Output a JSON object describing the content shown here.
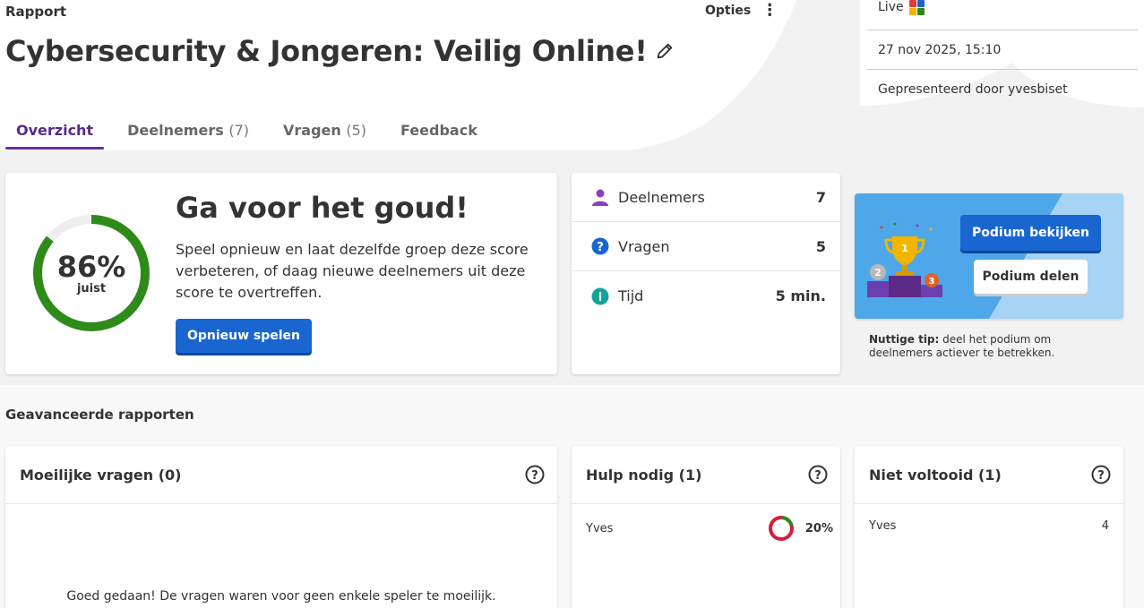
{
  "header": {
    "section_label": "Rapport",
    "options_label": "Opties",
    "options_icon": "more-vertical-icon",
    "title": "Cybersecurity & Jongeren: Veilig Online!",
    "edit_icon": "pencil-icon"
  },
  "tabs": [
    {
      "label": "Overzicht",
      "count": "",
      "active": true
    },
    {
      "label": "Deelnemers",
      "count": "(7)",
      "active": false
    },
    {
      "label": "Vragen",
      "count": "(5)",
      "active": false
    },
    {
      "label": "Feedback",
      "count": "",
      "active": false
    }
  ],
  "meta": {
    "mode": "Live",
    "date": "27 nov 2025, 15:10",
    "presenter": "Gepresenteerd door yvesbiset"
  },
  "score": {
    "percent_label": "86%",
    "percent_value": 86,
    "sub_label": "juist",
    "heading": "Ga voor het goud!",
    "body": "Speel opnieuw en laat dezelfde groep deze score verbeteren, of daag nieuwe deelnemers uit deze score te overtreffen.",
    "replay_label": "Opnieuw spelen",
    "color": "#2e8b1a"
  },
  "stats": [
    {
      "icon": "person-icon",
      "label": "Deelnemers",
      "value": "7"
    },
    {
      "icon": "question-icon",
      "label": "Vragen",
      "value": "5"
    },
    {
      "icon": "timer-icon",
      "label": "Tijd",
      "value": "5 min."
    }
  ],
  "podium": {
    "view_label": "Podium bekijken",
    "share_label": "Podium delen",
    "tip_bold": "Nuttige tip:",
    "tip_text": " deel het podium om deelnemers actiever te betrekken."
  },
  "advanced": {
    "title": "Geavanceerde rapporten",
    "difficult": {
      "title": "Moeilijke vragen (0)",
      "empty_text": "Goed gedaan! De vragen waren voor geen enkele speler te moeilijk."
    },
    "help_needed": {
      "title": "Hulp nodig (1)",
      "rows": [
        {
          "name": "Yves",
          "score_label": "20%",
          "score_value": 20
        }
      ]
    },
    "incomplete": {
      "title": "Niet voltooid (1)",
      "rows": [
        {
          "name": "Yves",
          "value": "4"
        }
      ]
    }
  }
}
